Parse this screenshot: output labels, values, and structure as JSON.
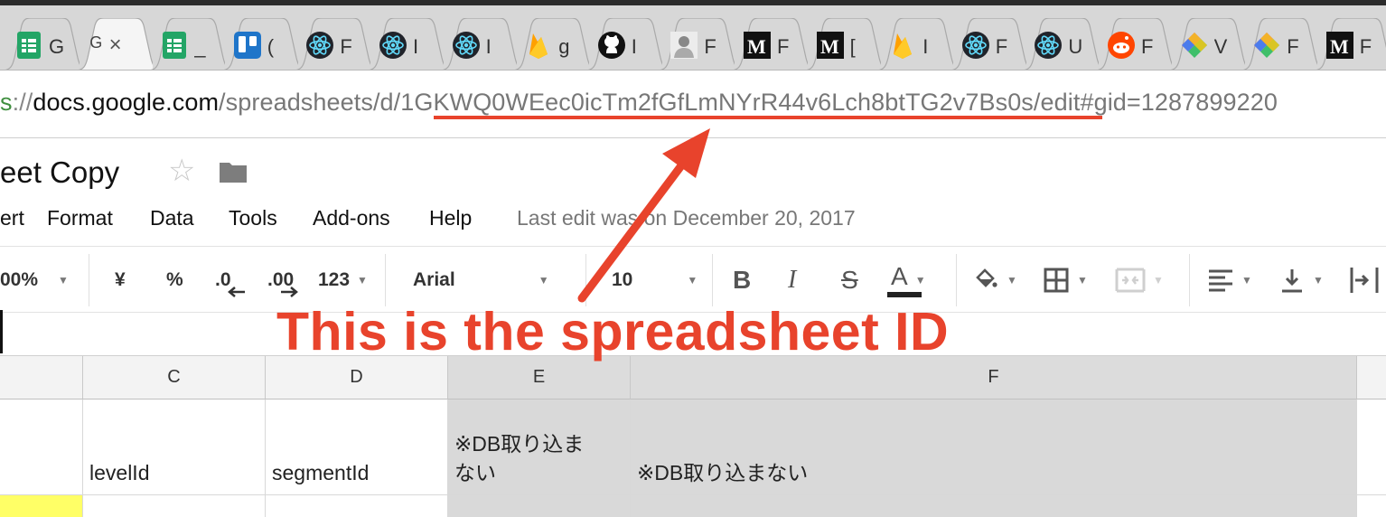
{
  "browser": {
    "tabs": [
      {
        "icon": "sheets-icon",
        "label": "G"
      },
      {
        "icon": "google-g-icon",
        "label": "G",
        "active": true
      },
      {
        "icon": "sheets-icon",
        "label": "_"
      },
      {
        "icon": "trello-icon",
        "label": "("
      },
      {
        "icon": "react-icon",
        "label": "F"
      },
      {
        "icon": "react-icon",
        "label": "I"
      },
      {
        "icon": "react-icon",
        "label": "I"
      },
      {
        "icon": "firebase-icon",
        "label": "g"
      },
      {
        "icon": "github-icon",
        "label": "I"
      },
      {
        "icon": "avatar-icon",
        "label": "F"
      },
      {
        "icon": "medium-icon",
        "label": "F"
      },
      {
        "icon": "medium-icon",
        "label": "["
      },
      {
        "icon": "firebase-icon",
        "label": "I"
      },
      {
        "icon": "react-icon",
        "label": "F"
      },
      {
        "icon": "react-icon",
        "label": "U"
      },
      {
        "icon": "reddit-icon",
        "label": "F"
      },
      {
        "icon": "colorful-icon",
        "label": "V"
      },
      {
        "icon": "colorful-icon",
        "label": "F"
      },
      {
        "icon": "medium-icon",
        "label": "F"
      }
    ],
    "active_tab_text": "G",
    "close_glyph": "×",
    "url": {
      "scheme": "s",
      "sep": "://",
      "host": "docs.google.com",
      "path_prefix": "/spreadsheets/d/",
      "id": "1GKWQ0WEec0icTm2fGfLmNYrR44v6Lch8btTG2v7Bs0s",
      "path_suffix": "/edit#gid=1287899220"
    }
  },
  "doc": {
    "title": "eet Copy",
    "star_glyph": "☆",
    "menus": [
      "ert",
      "Format",
      "Data",
      "Tools",
      "Add-ons",
      "Help"
    ],
    "last_edit": "Last edit was on December 20, 2017"
  },
  "toolbar": {
    "zoom": "00%",
    "currency": "¥",
    "percent": "%",
    "decimal_decrease": ".0",
    "decimal_increase": ".00",
    "more_formats": "123",
    "font": "Arial",
    "font_size": "10",
    "bold": "B",
    "italic": "I",
    "strikethrough": "S",
    "text_color": "A"
  },
  "grid": {
    "columns": [
      "C",
      "D",
      "E",
      "F"
    ],
    "row1": [
      "levelId",
      "segmentId",
      "※DB取り込まない",
      "※DB取り込まない"
    ],
    "row1_e_lines": [
      "※DB取り込ま",
      "ない"
    ]
  },
  "annotation": {
    "text": "This is the spreadsheet ID",
    "color": "#e8432c"
  }
}
